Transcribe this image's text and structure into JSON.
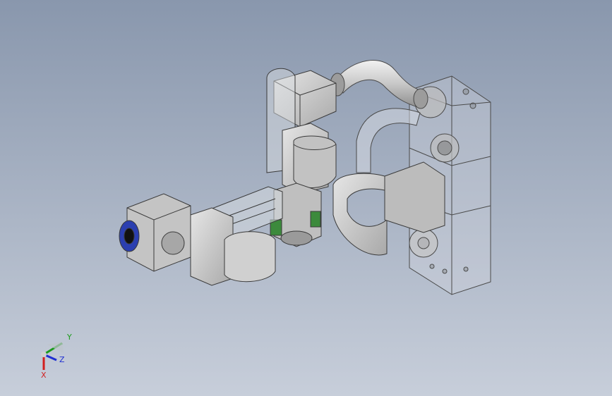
{
  "viewport": {
    "background_top": "#8997ad",
    "background_bottom": "#c7ceda"
  },
  "model": {
    "part_color": "#c9c9c9",
    "part_shadow": "#9a9a9a",
    "edge_color": "#3a3a3a",
    "glass_color": "#d8dce3",
    "accent_blue": "#2b3fb0",
    "accent_green": "#3c8a3c"
  },
  "triad": {
    "x_label": "X",
    "y_label": "Y",
    "z_label": "Z",
    "x_color": "#d21f1f",
    "y_color": "#1c9b1c",
    "z_color": "#1f2fd2"
  }
}
